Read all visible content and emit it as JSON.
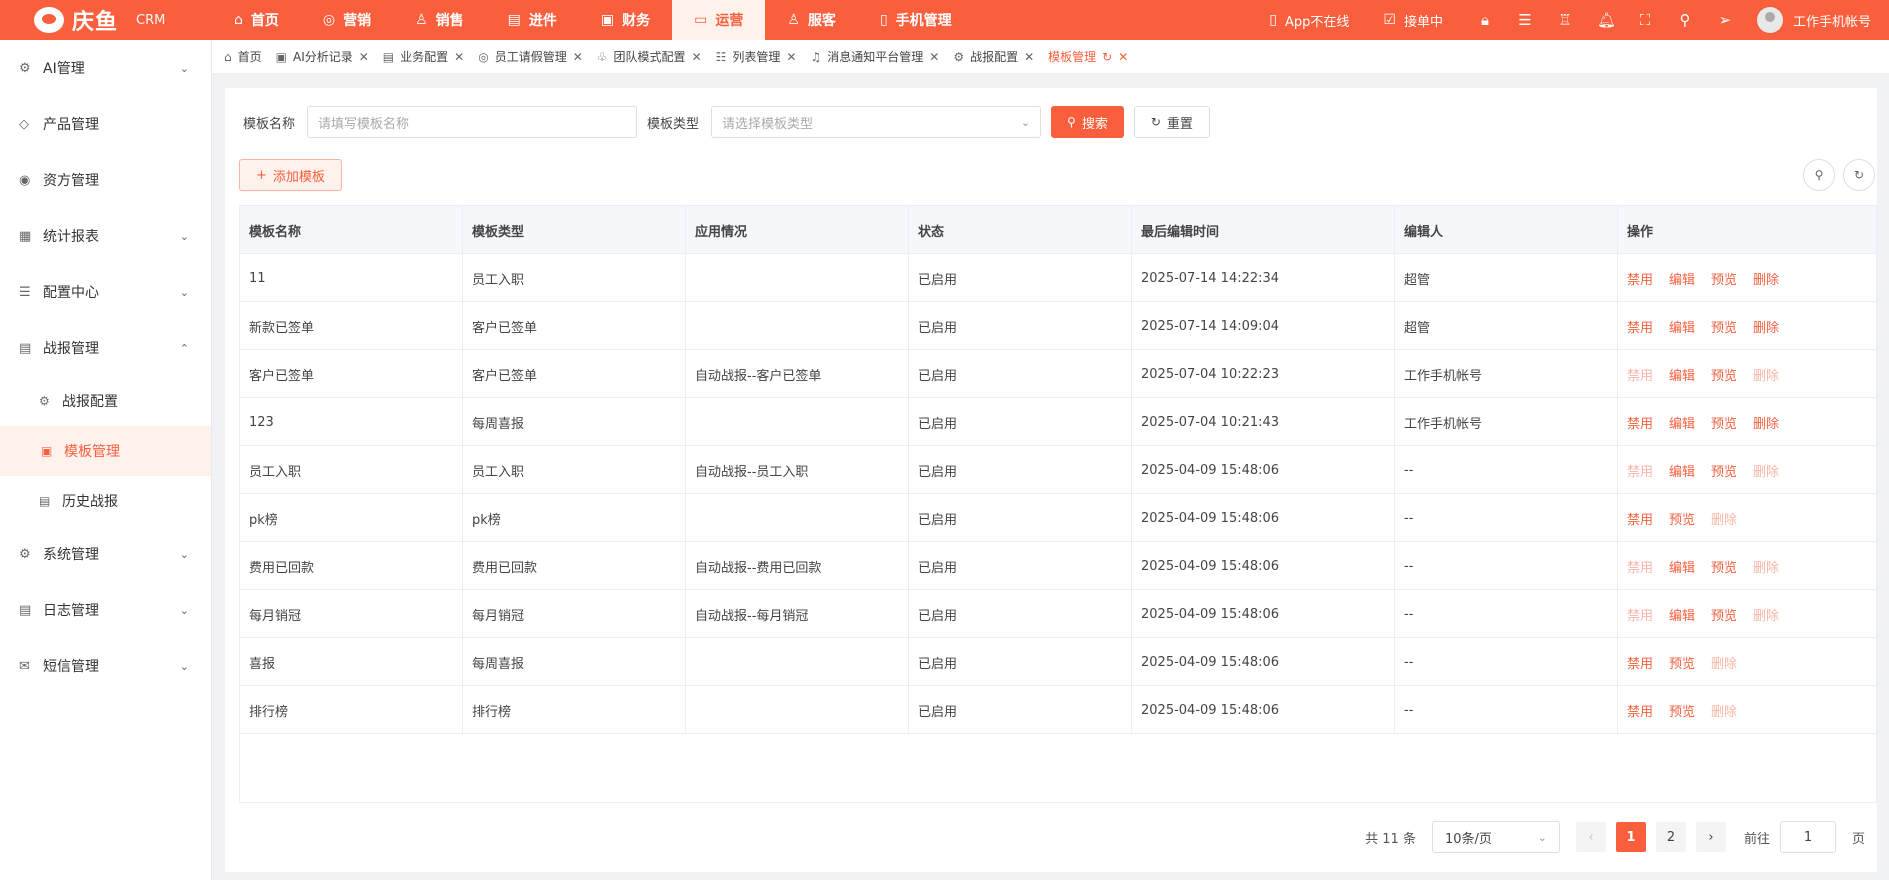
{
  "brand": {
    "logo_text": "庆鱼",
    "product": "CRM"
  },
  "topnav": [
    {
      "label": "首页",
      "icon": "home-icon",
      "glyph": "⌂"
    },
    {
      "label": "营销",
      "icon": "marketing-icon",
      "glyph": "◎"
    },
    {
      "label": "销售",
      "icon": "sales-icon",
      "glyph": "♙"
    },
    {
      "label": "进件",
      "icon": "document-icon",
      "glyph": "▤"
    },
    {
      "label": "财务",
      "icon": "finance-icon",
      "glyph": "▣"
    },
    {
      "label": "运营",
      "icon": "operation-icon",
      "glyph": "▭",
      "active": true
    },
    {
      "label": "服客",
      "icon": "service-icon",
      "glyph": "♙"
    },
    {
      "label": "手机管理",
      "icon": "phone-icon",
      "glyph": "▯"
    }
  ],
  "topright": {
    "app_status": "App不在线",
    "order_status": "接单中",
    "username": "工作手机帐号"
  },
  "sidebar": {
    "items": [
      {
        "label": "AI管理",
        "glyph": "⚙",
        "chevron": "⌄"
      },
      {
        "label": "产品管理",
        "glyph": "◇",
        "chevron": ""
      },
      {
        "label": "资方管理",
        "glyph": "◉",
        "chevron": ""
      },
      {
        "label": "统计报表",
        "glyph": "▦",
        "chevron": "⌄"
      },
      {
        "label": "配置中心",
        "glyph": "☰",
        "chevron": "⌄"
      },
      {
        "label": "战报管理",
        "glyph": "▤",
        "chevron": "⌃"
      }
    ],
    "subitems": [
      {
        "label": "战报配置",
        "glyph": "⚙"
      },
      {
        "label": "模板管理",
        "glyph": "▣",
        "active": true
      },
      {
        "label": "历史战报",
        "glyph": "▤"
      }
    ],
    "items_after": [
      {
        "label": "系统管理",
        "glyph": "⚙",
        "chevron": "⌄"
      },
      {
        "label": "日志管理",
        "glyph": "▤",
        "chevron": "⌄"
      },
      {
        "label": "短信管理",
        "glyph": "✉",
        "chevron": "⌄"
      }
    ]
  },
  "tabs": [
    {
      "label": "首页",
      "glyph": "⌂",
      "closable": false
    },
    {
      "label": "AI分析记录",
      "glyph": "▣",
      "closable": true
    },
    {
      "label": "业务配置",
      "glyph": "▤",
      "closable": true
    },
    {
      "label": "员工请假管理",
      "glyph": "◎",
      "closable": true
    },
    {
      "label": "团队模式配置",
      "glyph": "♧",
      "closable": true
    },
    {
      "label": "列表管理",
      "glyph": "☷",
      "closable": true
    },
    {
      "label": "消息通知平台管理",
      "glyph": "♫",
      "closable": true
    },
    {
      "label": "战报配置",
      "glyph": "⚙",
      "closable": true
    },
    {
      "label": "模板管理",
      "glyph": "",
      "closable": true,
      "active": true
    }
  ],
  "search": {
    "name_label": "模板名称",
    "name_placeholder": "请填写模板名称",
    "type_label": "模板类型",
    "type_placeholder": "请选择模板类型",
    "search_btn": "搜索",
    "reset_btn": "重置"
  },
  "add_btn": "添加模板",
  "table": {
    "columns": [
      "模板名称",
      "模板类型",
      "应用情况",
      "状态",
      "最后编辑时间",
      "编辑人",
      "操作"
    ],
    "rows": [
      {
        "name": "11",
        "type": "员工入职",
        "usage": "",
        "status": "已启用",
        "time": "2025-07-14 14:22:34",
        "editor": "超管",
        "actions": [
          [
            "禁用",
            false
          ],
          [
            "编辑",
            false
          ],
          [
            "预览",
            false
          ],
          [
            "删除",
            false
          ]
        ]
      },
      {
        "name": "新款已签单",
        "type": "客户已签单",
        "usage": "",
        "status": "已启用",
        "time": "2025-07-14 14:09:04",
        "editor": "超管",
        "actions": [
          [
            "禁用",
            false
          ],
          [
            "编辑",
            false
          ],
          [
            "预览",
            false
          ],
          [
            "删除",
            false
          ]
        ]
      },
      {
        "name": "客户已签单",
        "type": "客户已签单",
        "usage": "自动战报--客户已签单",
        "status": "已启用",
        "time": "2025-07-04 10:22:23",
        "editor": "工作手机帐号",
        "actions": [
          [
            "禁用",
            true
          ],
          [
            "编辑",
            false
          ],
          [
            "预览",
            false
          ],
          [
            "删除",
            true
          ]
        ]
      },
      {
        "name": "123",
        "type": "每周喜报",
        "usage": "",
        "status": "已启用",
        "time": "2025-07-04 10:21:43",
        "editor": "工作手机帐号",
        "actions": [
          [
            "禁用",
            false
          ],
          [
            "编辑",
            false
          ],
          [
            "预览",
            false
          ],
          [
            "删除",
            false
          ]
        ]
      },
      {
        "name": "员工入职",
        "type": "员工入职",
        "usage": "自动战报--员工入职",
        "status": "已启用",
        "time": "2025-04-09 15:48:06",
        "editor": "--",
        "actions": [
          [
            "禁用",
            true
          ],
          [
            "编辑",
            false
          ],
          [
            "预览",
            false
          ],
          [
            "删除",
            true
          ]
        ]
      },
      {
        "name": "pk榜",
        "type": "pk榜",
        "usage": "",
        "status": "已启用",
        "time": "2025-04-09 15:48:06",
        "editor": "--",
        "actions": [
          [
            "禁用",
            false
          ],
          [
            "预览",
            false
          ],
          [
            "删除",
            true
          ]
        ]
      },
      {
        "name": "费用已回款",
        "type": "费用已回款",
        "usage": "自动战报--费用已回款",
        "status": "已启用",
        "time": "2025-04-09 15:48:06",
        "editor": "--",
        "actions": [
          [
            "禁用",
            true
          ],
          [
            "编辑",
            false
          ],
          [
            "预览",
            false
          ],
          [
            "删除",
            true
          ]
        ]
      },
      {
        "name": "每月销冠",
        "type": "每月销冠",
        "usage": "自动战报--每月销冠",
        "status": "已启用",
        "time": "2025-04-09 15:48:06",
        "editor": "--",
        "actions": [
          [
            "禁用",
            true
          ],
          [
            "编辑",
            false
          ],
          [
            "预览",
            false
          ],
          [
            "删除",
            true
          ]
        ]
      },
      {
        "name": "喜报",
        "type": "每周喜报",
        "usage": "",
        "status": "已启用",
        "time": "2025-04-09 15:48:06",
        "editor": "--",
        "actions": [
          [
            "禁用",
            false
          ],
          [
            "预览",
            false
          ],
          [
            "删除",
            true
          ]
        ]
      },
      {
        "name": "排行榜",
        "type": "排行榜",
        "usage": "",
        "status": "已启用",
        "time": "2025-04-09 15:48:06",
        "editor": "--",
        "actions": [
          [
            "禁用",
            false
          ],
          [
            "预览",
            false
          ],
          [
            "删除",
            true
          ]
        ]
      }
    ]
  },
  "pagination": {
    "total": "共 11 条",
    "page_size": "10条/页",
    "pages": [
      "1",
      "2"
    ],
    "current": "1",
    "goto_label": "前往",
    "goto_value": "1",
    "page_suffix": "页"
  },
  "colors": {
    "accent": "#fa5f3d",
    "accent_light": "#fff1ec",
    "action_disabled": "#f9b5a4"
  }
}
